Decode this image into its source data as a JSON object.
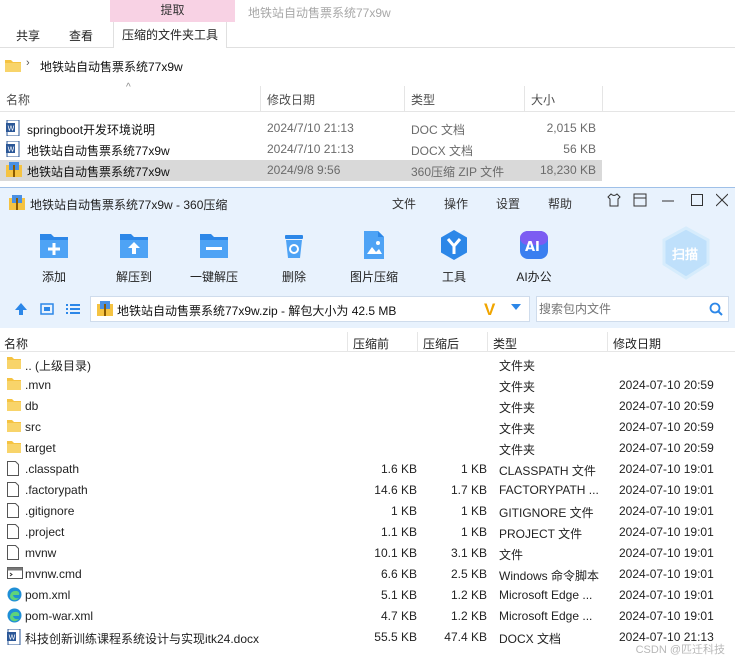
{
  "explorer": {
    "context_tab": "提取",
    "window_title": "地铁站自动售票系统77x9w",
    "ribbon_tabs": [
      "共享",
      "查看",
      "压缩的文件夹工具"
    ],
    "address": "地铁站自动售票系统77x9w",
    "columns": {
      "name": "名称",
      "date": "修改日期",
      "type": "类型",
      "size": "大小"
    },
    "files": [
      {
        "name": "springboot开发环境说明",
        "date": "2024/7/10 21:13",
        "type": "DOC 文档",
        "size": "2,015 KB",
        "icon": "word-doc-icon"
      },
      {
        "name": "地铁站自动售票系统77x9w",
        "date": "2024/7/10 21:13",
        "type": "DOCX 文档",
        "size": "56 KB",
        "icon": "word-doc-icon"
      },
      {
        "name": "地铁站自动售票系统77x9w",
        "date": "2024/9/8 9:56",
        "type": "360压缩 ZIP 文件",
        "size": "18,230 KB",
        "icon": "zip-archive-icon"
      }
    ]
  },
  "zip": {
    "title": "地铁站自动售票系统77x9w - 360压缩",
    "menu": [
      "文件",
      "操作",
      "设置",
      "帮助"
    ],
    "toolbar": [
      {
        "label": "添加",
        "icon": "add-icon"
      },
      {
        "label": "解压到",
        "icon": "extract-to-icon"
      },
      {
        "label": "一键解压",
        "icon": "one-click-extract-icon"
      },
      {
        "label": "删除",
        "icon": "delete-icon"
      },
      {
        "label": "图片压缩",
        "icon": "image-compress-icon"
      },
      {
        "label": "工具",
        "icon": "tools-icon"
      },
      {
        "label": "AI办公",
        "icon": "ai-office-icon"
      }
    ],
    "scan_label": "扫描",
    "path": "地铁站自动售票系统77x9w.zip - 解包大小为 42.5 MB",
    "search_placeholder": "搜索包内文件",
    "columns": {
      "name": "名称",
      "before": "压缩前",
      "after": "压缩后",
      "type": "类型",
      "date": "修改日期"
    },
    "files": [
      {
        "name": ".. (上级目录)",
        "before": "",
        "after": "",
        "type": "文件夹",
        "date": "",
        "icon": "folder-icon"
      },
      {
        "name": ".mvn",
        "before": "",
        "after": "",
        "type": "文件夹",
        "date": "2024-07-10 20:59",
        "icon": "folder-icon"
      },
      {
        "name": "db",
        "before": "",
        "after": "",
        "type": "文件夹",
        "date": "2024-07-10 20:59",
        "icon": "folder-icon"
      },
      {
        "name": "src",
        "before": "",
        "after": "",
        "type": "文件夹",
        "date": "2024-07-10 20:59",
        "icon": "folder-icon"
      },
      {
        "name": "target",
        "before": "",
        "after": "",
        "type": "文件夹",
        "date": "2024-07-10 20:59",
        "icon": "folder-icon"
      },
      {
        "name": ".classpath",
        "before": "1.6 KB",
        "after": "1 KB",
        "type": "CLASSPATH 文件",
        "date": "2024-07-10 19:01",
        "icon": "file-icon"
      },
      {
        "name": ".factorypath",
        "before": "14.6 KB",
        "after": "1.7 KB",
        "type": "FACTORYPATH ...",
        "date": "2024-07-10 19:01",
        "icon": "file-icon"
      },
      {
        "name": ".gitignore",
        "before": "1 KB",
        "after": "1 KB",
        "type": "GITIGNORE 文件",
        "date": "2024-07-10 19:01",
        "icon": "file-icon"
      },
      {
        "name": ".project",
        "before": "1.1 KB",
        "after": "1 KB",
        "type": "PROJECT 文件",
        "date": "2024-07-10 19:01",
        "icon": "file-icon"
      },
      {
        "name": "mvnw",
        "before": "10.1 KB",
        "after": "3.1 KB",
        "type": "文件",
        "date": "2024-07-10 19:01",
        "icon": "file-icon"
      },
      {
        "name": "mvnw.cmd",
        "before": "6.6 KB",
        "after": "2.5 KB",
        "type": "Windows 命令脚本",
        "date": "2024-07-10 19:01",
        "icon": "cmd-script-icon"
      },
      {
        "name": "pom.xml",
        "before": "5.1 KB",
        "after": "1.2 KB",
        "type": "Microsoft Edge ...",
        "date": "2024-07-10 19:01",
        "icon": "edge-icon"
      },
      {
        "name": "pom-war.xml",
        "before": "4.7 KB",
        "after": "1.2 KB",
        "type": "Microsoft Edge ...",
        "date": "2024-07-10 19:01",
        "icon": "edge-icon"
      },
      {
        "name": "科技创新训练课程系统设计与实现itk24.docx",
        "before": "55.5 KB",
        "after": "47.4 KB",
        "type": "DOCX 文档",
        "date": "2024-07-10 21:13",
        "icon": "word-doc-icon"
      }
    ]
  },
  "watermark": "CSDN @匹迁科技",
  "colors": {
    "accent": "#2c87e8",
    "header_bg": "#e8f2fd",
    "context_tab": "#f8d2e4",
    "selected_row": "#d9d9d9",
    "folder": "#f5c342"
  }
}
